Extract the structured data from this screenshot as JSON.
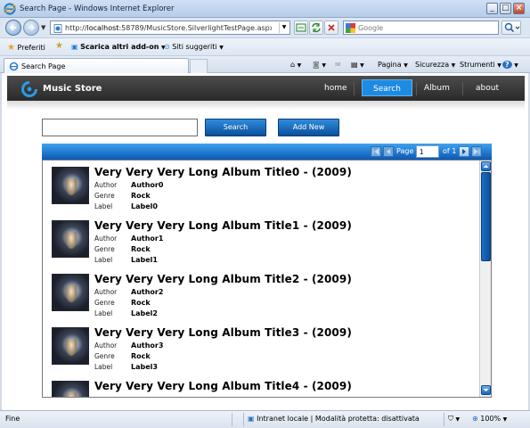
{
  "window": {
    "title": "Search Page - Windows Internet Explorer"
  },
  "address": {
    "url_prefix": "http://",
    "url_main": "localhost",
    "url_rest": ":58789/MusicStore.SilverlightTestPage.aspx#/Searcl"
  },
  "search": {
    "placeholder": "Google"
  },
  "favorites": {
    "favorites_label": "Preferiti",
    "addons_label": "Scarica altri add-on",
    "suggested_label": "Siti suggeriti"
  },
  "tab": {
    "title": "Search Page"
  },
  "commands": {
    "page": "Pagina",
    "security": "Sicurezza",
    "tools": "Strumenti"
  },
  "app": {
    "name": "Music Store",
    "nav": [
      {
        "label": "home"
      },
      {
        "label": "Search"
      },
      {
        "label": "Album"
      },
      {
        "label": "about"
      }
    ],
    "search_value": "",
    "search_button": "Search",
    "add_button": "Add New"
  },
  "pager": {
    "page_label": "Page",
    "page_value": "1",
    "of_label": "of 1"
  },
  "labels": {
    "author": "Author",
    "genre": "Genre",
    "label": "Label"
  },
  "albums": [
    {
      "title": "Very Very Very Long Album Title0 - (2009)",
      "author": "Author0",
      "genre": "Rock",
      "label": "Label0"
    },
    {
      "title": "Very Very Very Long Album Title1 - (2009)",
      "author": "Author1",
      "genre": "Rock",
      "label": "Label1"
    },
    {
      "title": "Very Very Very Long Album Title2 - (2009)",
      "author": "Author2",
      "genre": "Rock",
      "label": "Label2"
    },
    {
      "title": "Very Very Very Long Album Title3 - (2009)",
      "author": "Author3",
      "genre": "Rock",
      "label": "Label3"
    },
    {
      "title": "Very Very Very Long Album Title4 - (2009)",
      "author": "",
      "genre": "",
      "label": ""
    }
  ],
  "status": {
    "text": "Fine",
    "zone": "Intranet locale | Modalità protetta: disattivata",
    "zoom": "100%"
  },
  "colors": {
    "accent": "#1e8be3",
    "header_bg": "#333333",
    "pager_blue": "#0c58b3"
  }
}
